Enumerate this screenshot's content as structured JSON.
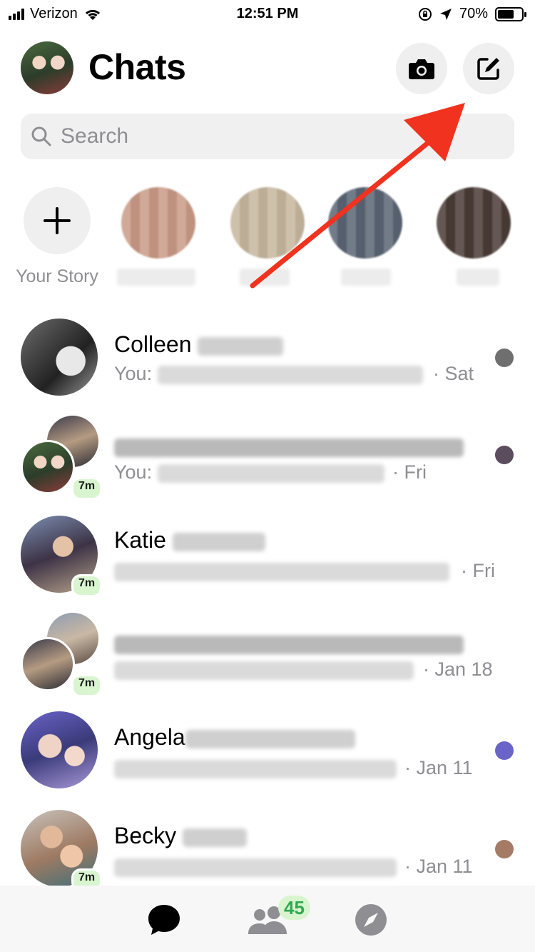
{
  "status_bar": {
    "carrier": "Verizon",
    "time": "12:51 PM",
    "battery_percent": "70%",
    "battery_level": 0.7,
    "icons": [
      "signal-icon",
      "wifi-icon",
      "rotation-lock-icon",
      "location-icon",
      "battery-icon"
    ]
  },
  "header": {
    "title": "Chats",
    "buttons": [
      "camera-icon",
      "compose-icon"
    ]
  },
  "search": {
    "placeholder": "Search"
  },
  "stories": {
    "add_label": "Your Story"
  },
  "chats": [
    {
      "name": "Colleen",
      "preview_prefix": "You:",
      "time": "· Sat",
      "badge": ""
    },
    {
      "name": "",
      "preview_prefix": "You:",
      "time": "· Fri",
      "badge": "7m"
    },
    {
      "name": "Katie",
      "preview_prefix": "",
      "time": "· Fri",
      "badge": "7m"
    },
    {
      "name": "",
      "preview_prefix": "",
      "time": "· Jan 18",
      "badge": "7m"
    },
    {
      "name": "Angela",
      "preview_prefix": "",
      "time": "· Jan 11",
      "badge": ""
    },
    {
      "name": "Becky",
      "preview_prefix": "",
      "time": "· Jan 11",
      "badge": "7m"
    }
  ],
  "tab_bar": {
    "tabs": [
      "chats-icon",
      "people-icon",
      "discover-icon"
    ],
    "people_badge": "45"
  },
  "colors": {
    "annotation_arrow": "#f0321e",
    "badge_bg": "#d8f5cf",
    "badge_text": "#32a852",
    "secondary_text": "#8e8e93"
  }
}
